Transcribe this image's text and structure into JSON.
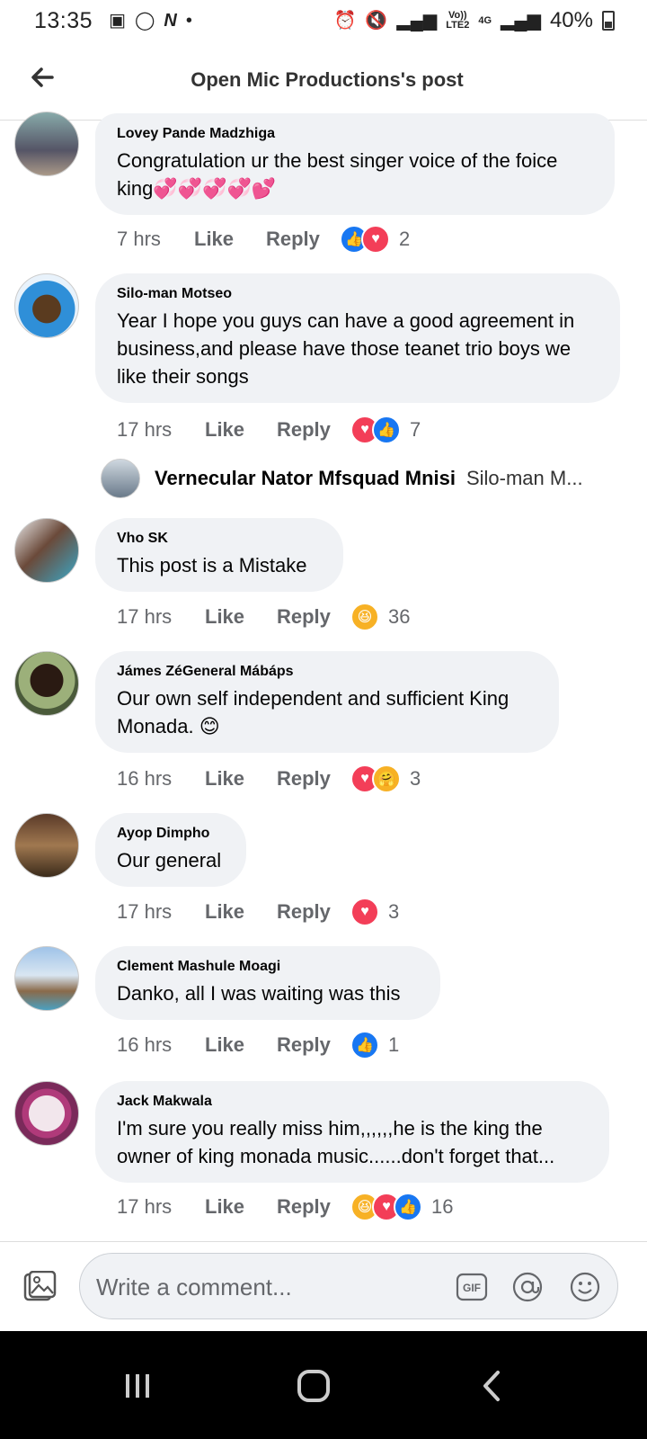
{
  "status_bar": {
    "time": "13:35",
    "dot": "•",
    "network_top": "Vo))",
    "network_bottom": "LTE2",
    "network_type": "4G",
    "battery": "40%"
  },
  "header": {
    "title": "Open Mic Productions's post"
  },
  "comments": [
    {
      "author": "Lovey Pande Madzhiga",
      "text": "Congratulation ur the best singer voice of the foice king💞💞💞💞💕",
      "age": "7 hrs",
      "like": "Like",
      "reply": "Reply",
      "reactions": [
        "like",
        "love"
      ],
      "count": "2"
    },
    {
      "author": "Silo-man Motseo",
      "text": "Year I hope you guys can have a good agreement in business,and please have those teanet trio boys we like their songs",
      "age": "17 hrs",
      "like": "Like",
      "reply": "Reply",
      "reactions": [
        "love",
        "like"
      ],
      "count": "7"
    },
    {
      "author": "Vho SK",
      "text": "This post is a Mistake",
      "age": "17 hrs",
      "like": "Like",
      "reply": "Reply",
      "reactions": [
        "haha"
      ],
      "count": "36"
    },
    {
      "author": "Jámes ZéGeneral Mábáps",
      "text": "Our own self independent and sufficient King Monada. 😊",
      "age": "16 hrs",
      "like": "Like",
      "reply": "Reply",
      "reactions": [
        "love",
        "care"
      ],
      "count": "3"
    },
    {
      "author": "Ayop Dimpho",
      "text": "Our general",
      "age": "17 hrs",
      "like": "Like",
      "reply": "Reply",
      "reactions": [
        "love"
      ],
      "count": "3"
    },
    {
      "author": "Clement Mashule Moagi",
      "text": "Danko, all I was waiting was this",
      "age": "16 hrs",
      "like": "Like",
      "reply": "Reply",
      "reactions": [
        "like"
      ],
      "count": "1"
    },
    {
      "author": "Jack Makwala",
      "text": "I'm sure you really miss him,,,,,,he is the king the owner of king monada music......don't forget that...",
      "age": "17 hrs",
      "like": "Like",
      "reply": "Reply",
      "reactions": [
        "haha",
        "love",
        "like"
      ],
      "count": "16"
    }
  ],
  "reply_preview": {
    "author": "Vernecular Nator Mfsquad Mnisi",
    "snippet": "Silo-man M..."
  },
  "composer": {
    "placeholder": "Write a comment...",
    "gif": "GIF"
  },
  "icons": {
    "back": "back-arrow-icon",
    "photo": "photo-icon",
    "mention": "mention-icon",
    "emoji": "emoji-icon",
    "nav_recents": "recents-icon",
    "nav_home": "home-icon",
    "nav_back": "nav-back-icon"
  },
  "colors": {
    "like": "#1877f2",
    "love": "#f33e58",
    "haha": "#f7b125",
    "bubble": "#f0f2f5",
    "meta": "#65676b"
  }
}
